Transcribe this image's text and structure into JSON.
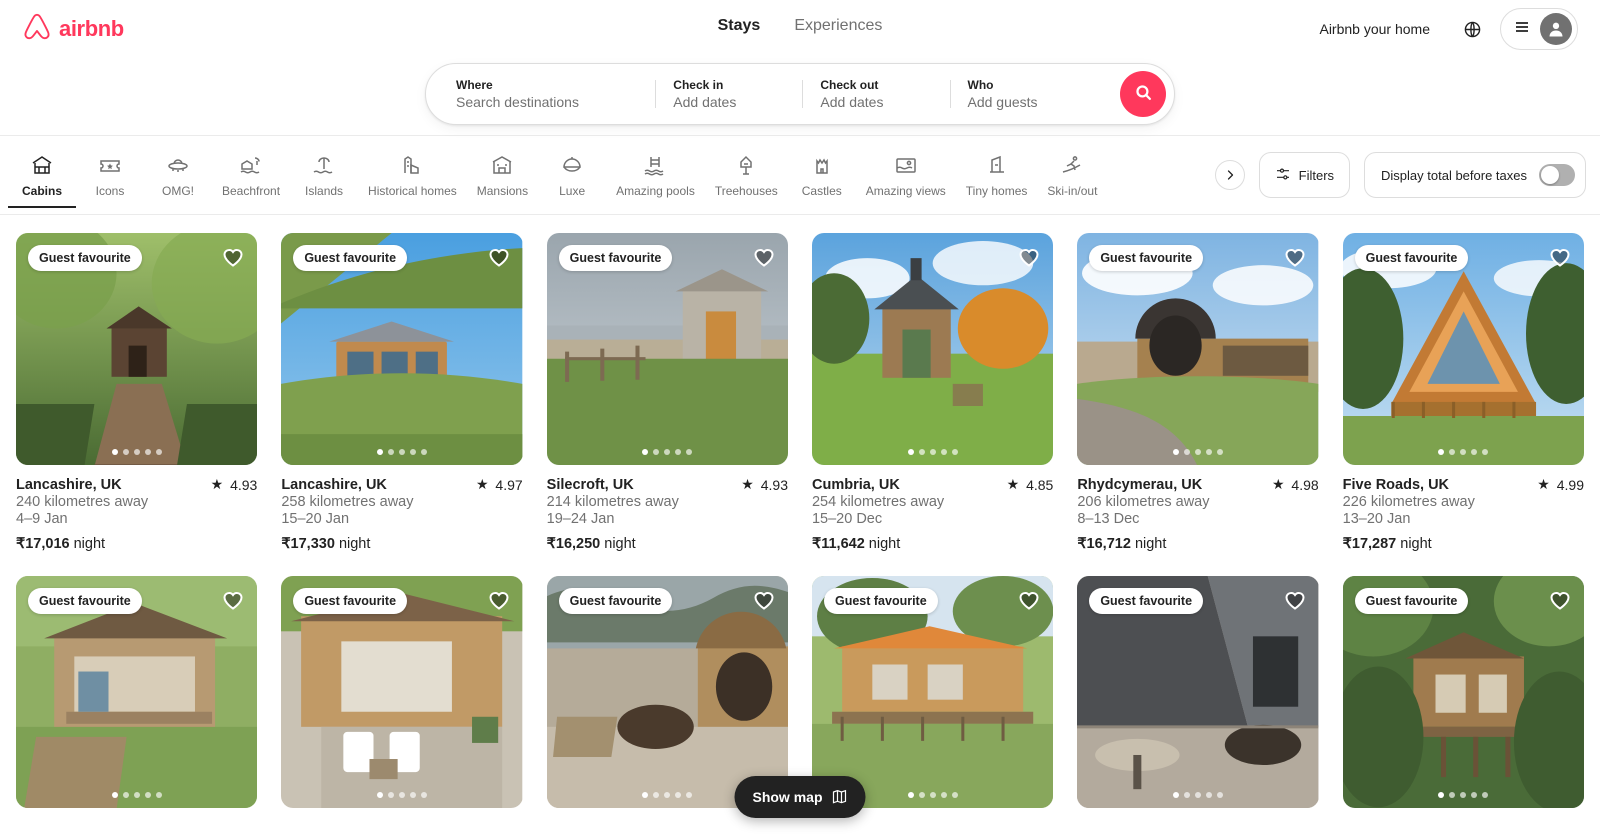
{
  "header": {
    "logo_text": "airbnb",
    "logo_icon": "airbnb-belo-icon",
    "tabs": [
      {
        "label": "Stays",
        "active": true
      },
      {
        "label": "Experiences",
        "active": false
      }
    ],
    "host_link": "Airbnb your home",
    "globe_icon": "globe-icon",
    "menu_icon": "hamburger-menu-icon",
    "avatar_icon": "user-avatar-icon"
  },
  "search": {
    "where_label": "Where",
    "where_placeholder": "Search destinations",
    "checkin_label": "Check in",
    "checkin_value": "Add dates",
    "checkout_label": "Check out",
    "checkout_value": "Add dates",
    "who_label": "Who",
    "who_value": "Add guests",
    "search_icon": "search-icon",
    "search_button_color": "#ff385c"
  },
  "categories": [
    {
      "label": "Cabins",
      "icon": "cabin-icon",
      "active": true
    },
    {
      "label": "Icons",
      "icon": "ticket-star-icon",
      "active": false
    },
    {
      "label": "OMG!",
      "icon": "ufo-icon",
      "active": false
    },
    {
      "label": "Beachfront",
      "icon": "beachfront-icon",
      "active": false
    },
    {
      "label": "Islands",
      "icon": "island-palm-icon",
      "active": false
    },
    {
      "label": "Historical homes",
      "icon": "historical-home-icon",
      "active": false
    },
    {
      "label": "Mansions",
      "icon": "mansion-icon",
      "active": false
    },
    {
      "label": "Luxe",
      "icon": "luxe-dome-icon",
      "active": false
    },
    {
      "label": "Amazing pools",
      "icon": "pool-icon",
      "active": false
    },
    {
      "label": "Treehouses",
      "icon": "treehouse-icon",
      "active": false
    },
    {
      "label": "Castles",
      "icon": "castle-icon",
      "active": false
    },
    {
      "label": "Amazing views",
      "icon": "amazing-views-icon",
      "active": false
    },
    {
      "label": "Tiny homes",
      "icon": "tiny-home-icon",
      "active": false
    },
    {
      "label": "Ski-in/out",
      "icon": "skier-icon",
      "active": false
    }
  ],
  "toolbar": {
    "scroll_next_icon": "chevron-right-icon",
    "filters_label": "Filters",
    "filters_icon": "sliders-icon",
    "taxes_label": "Display total before taxes",
    "taxes_toggle_on": false
  },
  "listings": [
    {
      "badge": "Guest favourite",
      "location": "Lancashire, UK",
      "rating": "4.93",
      "distance": "240 kilometres away",
      "dates": "4–9 Jan",
      "price": "₹17,016",
      "price_unit": "night",
      "dots": 5,
      "active_dot": 0
    },
    {
      "badge": "Guest favourite",
      "location": "Lancashire, UK",
      "rating": "4.97",
      "distance": "258 kilometres away",
      "dates": "15–20 Jan",
      "price": "₹17,330",
      "price_unit": "night",
      "dots": 5,
      "active_dot": 0
    },
    {
      "badge": "Guest favourite",
      "location": "Silecroft, UK",
      "rating": "4.93",
      "distance": "214 kilometres away",
      "dates": "19–24 Jan",
      "price": "₹16,250",
      "price_unit": "night",
      "dots": 5,
      "active_dot": 0
    },
    {
      "badge": "",
      "location": "Cumbria, UK",
      "rating": "4.85",
      "distance": "254 kilometres away",
      "dates": "15–20 Dec",
      "price": "₹11,642",
      "price_unit": "night",
      "dots": 5,
      "active_dot": 0
    },
    {
      "badge": "Guest favourite",
      "location": "Rhydcymerau, UK",
      "rating": "4.98",
      "distance": "206 kilometres away",
      "dates": "8–13 Dec",
      "price": "₹16,712",
      "price_unit": "night",
      "dots": 5,
      "active_dot": 0
    },
    {
      "badge": "Guest favourite",
      "location": "Five Roads, UK",
      "rating": "4.99",
      "distance": "226 kilometres away",
      "dates": "13–20 Jan",
      "price": "₹17,287",
      "price_unit": "night",
      "dots": 5,
      "active_dot": 0
    }
  ],
  "listings_row2": [
    {
      "badge": "Guest favourite",
      "dots": 5,
      "active_dot": 0
    },
    {
      "badge": "Guest favourite",
      "dots": 5,
      "active_dot": 0
    },
    {
      "badge": "Guest favourite",
      "dots": 5,
      "active_dot": 0
    },
    {
      "badge": "Guest favourite",
      "dots": 5,
      "active_dot": 0
    },
    {
      "badge": "Guest favourite",
      "dots": 5,
      "active_dot": 0
    },
    {
      "badge": "Guest favourite",
      "dots": 5,
      "active_dot": 0
    }
  ],
  "show_map": {
    "label": "Show map",
    "icon": "map-icon"
  }
}
